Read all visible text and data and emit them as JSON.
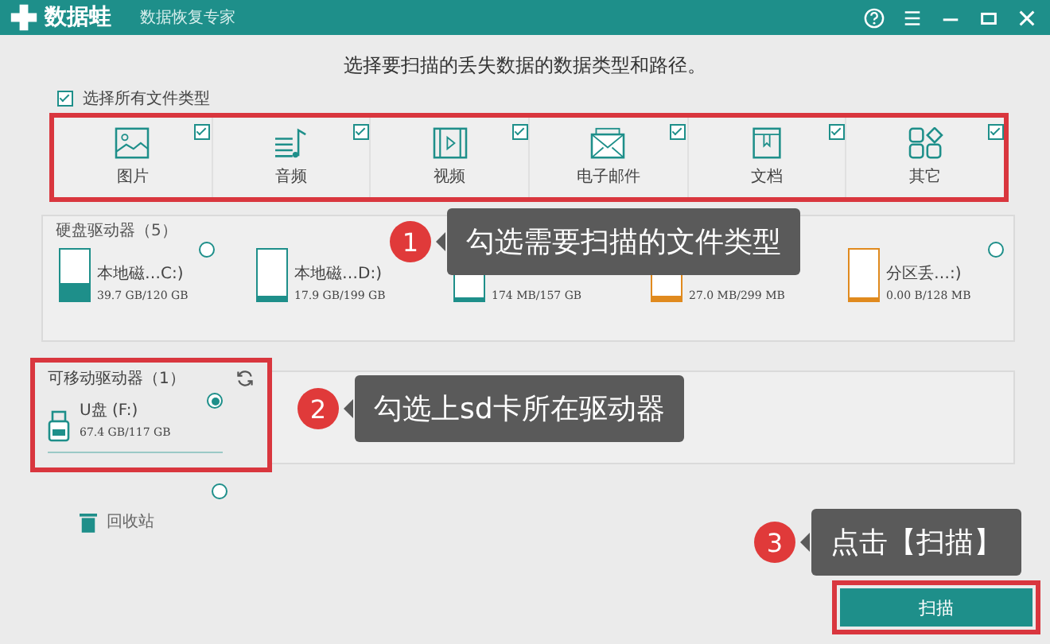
{
  "app": {
    "logo": "数据蛙",
    "subtitle": "数据恢复专家"
  },
  "heading": "选择要扫描的丢失数据的数据类型和路径。",
  "select_all": {
    "label": "选择所有文件类型",
    "checked": true
  },
  "categories": [
    {
      "kind": "image",
      "label": "图片",
      "checked": true
    },
    {
      "kind": "audio",
      "label": "音频",
      "checked": true
    },
    {
      "kind": "video",
      "label": "视频",
      "checked": true
    },
    {
      "kind": "email",
      "label": "电子邮件",
      "checked": true
    },
    {
      "kind": "document",
      "label": "文档",
      "checked": true
    },
    {
      "kind": "other",
      "label": "其它",
      "checked": true
    }
  ],
  "hard_drives": {
    "title": "硬盘驱动器（5）",
    "drives": [
      {
        "name": "本地磁…C:)",
        "capacity": "39.7 GB/120 GB",
        "level": 0.33,
        "color": "#1e8f8a",
        "selected": false
      },
      {
        "name": "本地磁…D:)",
        "capacity": "17.9 GB/199 GB",
        "level": 0.09,
        "color": "#1e8f8a"
      },
      {
        "capacity": "174 MB/157 GB",
        "level": 0.0,
        "color": "#1e8f8a"
      },
      {
        "capacity": "27.0 MB/299 MB",
        "level": 0.09,
        "color": "#e08a1e"
      },
      {
        "name": "分区丢…:)",
        "capacity": "0.00  B/128 MB",
        "level": 0.0,
        "color": "#e08a1e",
        "selected": false
      }
    ]
  },
  "removable": {
    "title": "可移动驱动器（1）",
    "drives": [
      {
        "name": "U盘 (F:)",
        "capacity": "67.4 GB/117 GB",
        "selected": true
      }
    ]
  },
  "recycle_bin": {
    "label": "回收站",
    "selected": false
  },
  "scan_button": "扫描",
  "annotations": [
    {
      "number": "1",
      "text": "勾选需要扫描的文件类型"
    },
    {
      "number": "2",
      "text": "勾选上sd卡所在驱动器"
    },
    {
      "number": "3",
      "text": "点击【扫描】"
    }
  ]
}
